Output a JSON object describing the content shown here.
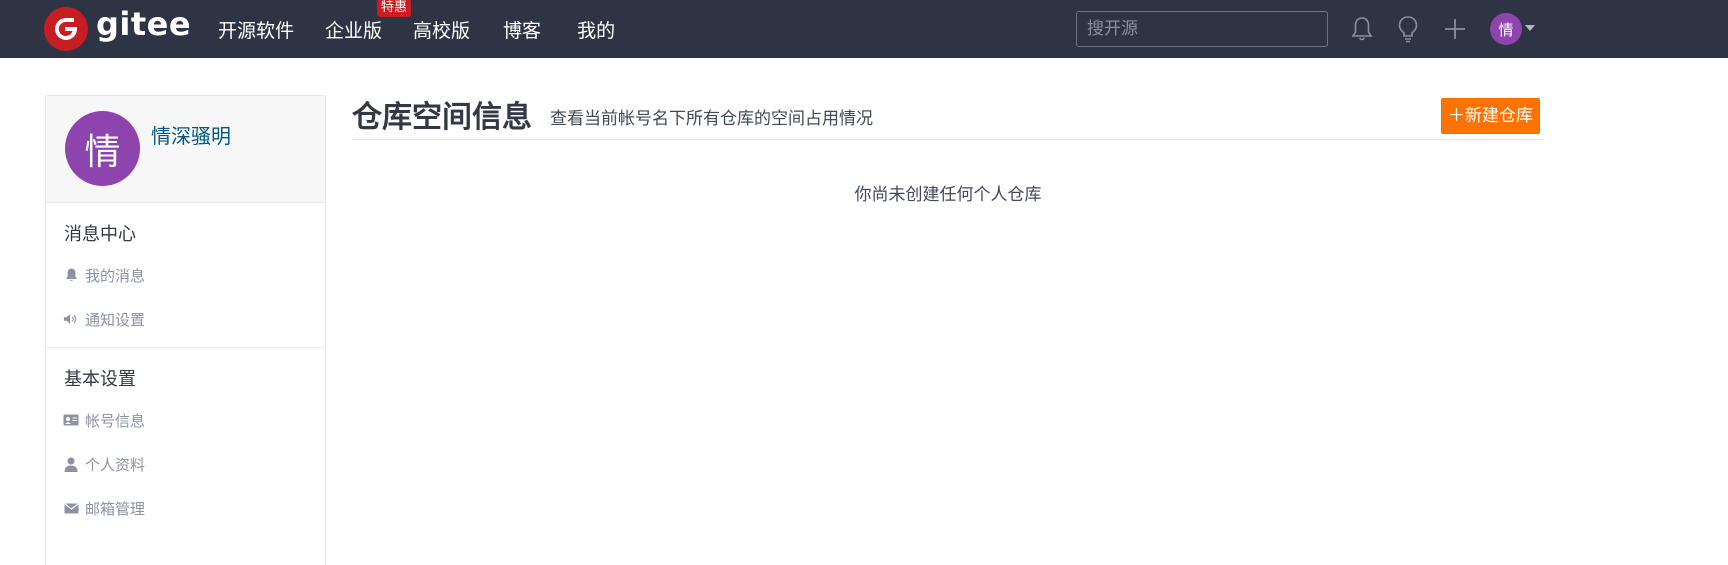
{
  "brand": {
    "logo_letter": "G",
    "logo_text": "gitee",
    "accent_color": "#c71d23"
  },
  "nav": {
    "items": [
      {
        "label": "开源软件"
      },
      {
        "label": "企业版",
        "badge": "特惠"
      },
      {
        "label": "高校版"
      },
      {
        "label": "博客"
      },
      {
        "label": "我的"
      }
    ]
  },
  "search": {
    "placeholder": "搜开源"
  },
  "top_icons": [
    "bell-icon",
    "lightbulb-icon",
    "plus-icon"
  ],
  "user": {
    "avatar_char": "情",
    "name": "情深骚明",
    "avatar_color": "#8e44ad"
  },
  "sidebar": {
    "sections": [
      {
        "title": "消息中心",
        "items": [
          {
            "label": "我的消息",
            "icon": "bell-icon"
          },
          {
            "label": "通知设置",
            "icon": "megaphone-icon"
          }
        ]
      },
      {
        "title": "基本设置",
        "items": [
          {
            "label": "帐号信息",
            "icon": "id-card-icon"
          },
          {
            "label": "个人资料",
            "icon": "user-icon"
          },
          {
            "label": "邮箱管理",
            "icon": "envelope-icon"
          }
        ]
      }
    ]
  },
  "main": {
    "title": "仓库空间信息",
    "subtitle": "查看当前帐号名下所有仓库的空间占用情况",
    "new_repo_button": "＋新建仓库",
    "new_repo_color": "#fe7300",
    "empty_message": "你尚未创建任何个人仓库"
  }
}
